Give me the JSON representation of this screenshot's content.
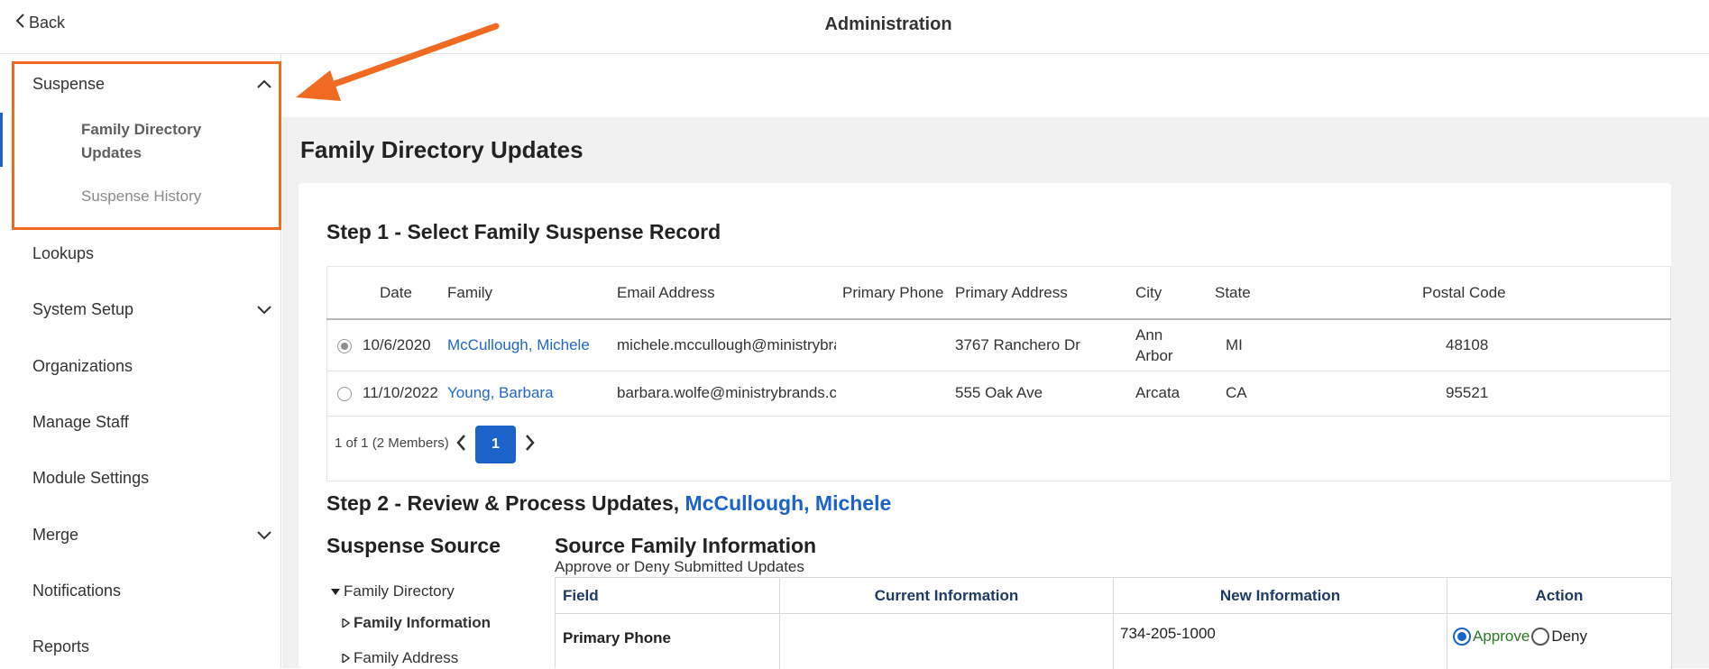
{
  "header": {
    "back_label": "Back",
    "title": "Administration"
  },
  "sidebar": {
    "suspense": {
      "label": "Suspense",
      "children": [
        "Family Directory Updates",
        "Suspense History"
      ]
    },
    "items": [
      "Lookups",
      "System Setup",
      "Organizations",
      "Manage Staff",
      "Module Settings",
      "Merge",
      "Notifications",
      "Reports"
    ]
  },
  "main": {
    "title": "Family Directory Updates",
    "step1": {
      "title": "Step 1 - Select Family Suspense Record",
      "columns": [
        "Date",
        "Family",
        "Email Address",
        "Primary Phone",
        "Primary Address",
        "City",
        "State",
        "Postal Code"
      ],
      "rows": [
        {
          "date": "10/6/2020",
          "family": "McCullough, Michele",
          "email": "michele.mccullough@ministrybrands.com",
          "phone": "",
          "address": "3767 Ranchero Dr",
          "city_line1": "Ann",
          "city_line2": "Arbor",
          "state": "MI",
          "postal": "48108",
          "selected": true
        },
        {
          "date": "11/10/2022",
          "family": "Young, Barbara",
          "email": "barbara.wolfe@ministrybrands.com",
          "phone": "",
          "address": "555 Oak Ave",
          "city": "Arcata",
          "state": "CA",
          "postal": "95521",
          "selected": false
        }
      ],
      "pager": {
        "summary": "1 of 1 (2 Members)",
        "current_page": "1"
      }
    },
    "step2": {
      "title": "Step 2 - Review & Process Updates,",
      "family": "McCullough, Michele",
      "source": {
        "title": "Suspense Source",
        "tree": [
          "Family Directory",
          "Family Information",
          "Family Address"
        ]
      },
      "info": {
        "title": "Source Family Information",
        "subtitle": "Approve or Deny Submitted Updates",
        "columns": [
          "Field",
          "Current Information",
          "New Information",
          "Action"
        ],
        "rows": [
          {
            "field": "Primary Phone",
            "current": "",
            "new": "734-205-1000",
            "approve_label": "Approve",
            "deny_label": "Deny",
            "action": "Approve"
          }
        ]
      }
    }
  },
  "colors": {
    "accent": "#1b62c9",
    "link": "#2266cc",
    "annotation": "#f06a21",
    "approve": "#2a7a22"
  }
}
